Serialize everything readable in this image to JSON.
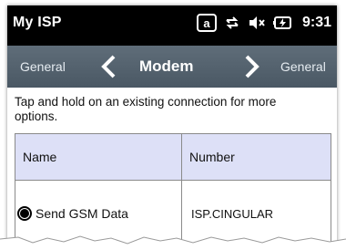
{
  "statusbar": {
    "app_title": "My ISP",
    "icons": [
      "keyboard-a-icon",
      "data-transfer-icon",
      "speaker-mute-icon",
      "battery-charging-icon"
    ],
    "time": "9:31"
  },
  "nav": {
    "prev_label": "General",
    "current_label": "Modem",
    "next_label": "General"
  },
  "hint_text": "Tap and hold on an existing connection for more options.",
  "table": {
    "headers": [
      "Name",
      "Number"
    ],
    "rows": [
      {
        "name": "Send GSM Data",
        "number": "ISP.CINGULAR",
        "selected": true
      }
    ]
  },
  "colors": {
    "statusbar_bg": "#000000",
    "navbar_bg": "#55626e",
    "table_header_bg": "#dde0f7"
  }
}
